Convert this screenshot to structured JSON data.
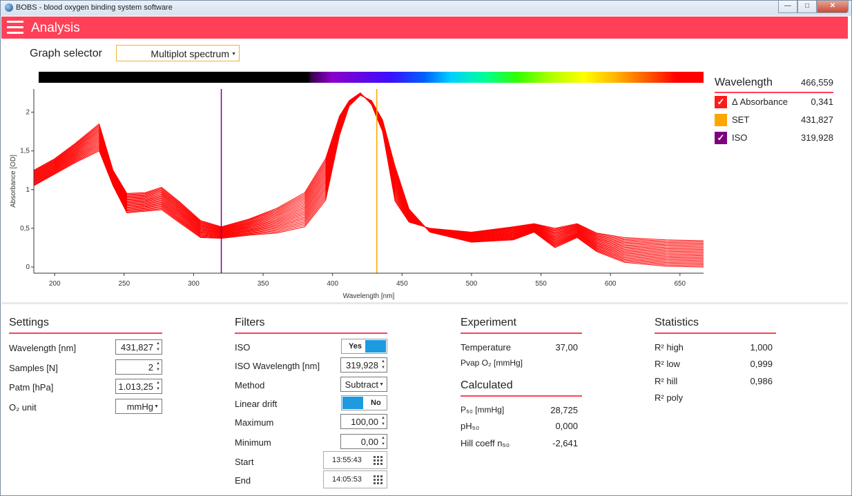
{
  "window": {
    "title": "BOBS - blood oxygen binding system software"
  },
  "appbar": {
    "title": "Analysis"
  },
  "graph_selector": {
    "label": "Graph selector",
    "value": "Multiplot spectrum"
  },
  "legend": {
    "title": "Wavelength",
    "value": "466,559",
    "items": [
      {
        "name": "Δ Absorbance",
        "value": "0,341",
        "color": "#ff0000"
      },
      {
        "name": "SET",
        "value": "431,827",
        "color": "#ffa500"
      },
      {
        "name": "ISO",
        "value": "319,928",
        "color": "#800080"
      }
    ]
  },
  "chart_data": {
    "type": "line",
    "xlabel": "Wavelength [nm]",
    "ylabel": "Absorbance [OD]",
    "xlim": [
      185,
      667
    ],
    "ylim": [
      -0.08,
      2.3
    ],
    "xticks": [
      "200",
      "250",
      "300",
      "350",
      "400",
      "450",
      "500",
      "550",
      "600",
      "650"
    ],
    "yticks": [
      "0",
      "0,5",
      "1",
      "1,5",
      "2"
    ],
    "grid": false,
    "markers": [
      {
        "name": "ISO",
        "x": 319.928,
        "color": "#800080"
      },
      {
        "name": "SET",
        "x": 431.827,
        "color": "#ffa500"
      }
    ],
    "series_color": "#ff0000",
    "series_count": 22,
    "reference_x": [
      185,
      200,
      215,
      232,
      242,
      252,
      265,
      277,
      290,
      305,
      320,
      340,
      360,
      380,
      395,
      405,
      412,
      420,
      428,
      436,
      445,
      455,
      470,
      500,
      530,
      545,
      560,
      576,
      590,
      610,
      640,
      667
    ],
    "series_first": [
      1.25,
      1.4,
      1.6,
      1.85,
      1.25,
      0.95,
      0.96,
      1.03,
      0.84,
      0.6,
      0.52,
      0.62,
      0.76,
      0.96,
      1.4,
      1.95,
      2.15,
      2.25,
      2.1,
      1.75,
      0.85,
      0.58,
      0.5,
      0.45,
      0.52,
      0.56,
      0.5,
      0.56,
      0.44,
      0.38,
      0.35,
      0.34
    ],
    "series_last": [
      1.05,
      1.2,
      1.35,
      1.5,
      1.05,
      0.7,
      0.72,
      0.74,
      0.57,
      0.38,
      0.37,
      0.41,
      0.44,
      0.52,
      0.86,
      1.7,
      2.08,
      2.22,
      2.15,
      1.9,
      1.3,
      0.75,
      0.45,
      0.32,
      0.35,
      0.45,
      0.25,
      0.38,
      0.2,
      0.06,
      0.01,
      0.0
    ]
  },
  "settings": {
    "title": "Settings",
    "fields": [
      {
        "label": "Wavelength [nm]",
        "value": "431,827"
      },
      {
        "label": "Samples [N]",
        "value": "2"
      },
      {
        "label": "Patm [hPa]",
        "value": "1.013,25"
      },
      {
        "label": "O₂ unit",
        "value": "mmHg"
      }
    ]
  },
  "filters": {
    "title": "Filters",
    "iso": {
      "label": "ISO",
      "state": "Yes"
    },
    "iso_wavelength": {
      "label": "ISO Wavelength [nm]",
      "value": "319,928"
    },
    "method": {
      "label": "Method",
      "value": "Subtract"
    },
    "linear_drift": {
      "label": "Linear drift",
      "state": "No"
    },
    "maximum": {
      "label": "Maximum",
      "value": "100,00"
    },
    "minimum": {
      "label": "Minimum",
      "value": "0,00"
    },
    "start": {
      "label": "Start",
      "value": "13:55:43"
    },
    "end": {
      "label": "End",
      "value": "14:05:53"
    }
  },
  "experiment": {
    "title": "Experiment",
    "temperature": {
      "label": "Temperature",
      "value": "37,00"
    },
    "pvap": {
      "label": "Pvap O₂ [mmHg]",
      "value": ""
    }
  },
  "calculated": {
    "title": "Calculated",
    "p50": {
      "label": "P₅₀ [mmHg]",
      "value": "28,725"
    },
    "ph50": {
      "label": "pH₅₀",
      "value": "0,000"
    },
    "hill": {
      "label": "Hill coeff n₅₀",
      "value": "-2,641"
    }
  },
  "statistics": {
    "title": "Statistics",
    "rows": [
      {
        "label": "R² high",
        "value": "1,000"
      },
      {
        "label": "R² low",
        "value": "0,999"
      },
      {
        "label": "R² hill",
        "value": "0,986"
      },
      {
        "label": "R² poly",
        "value": ""
      }
    ]
  }
}
